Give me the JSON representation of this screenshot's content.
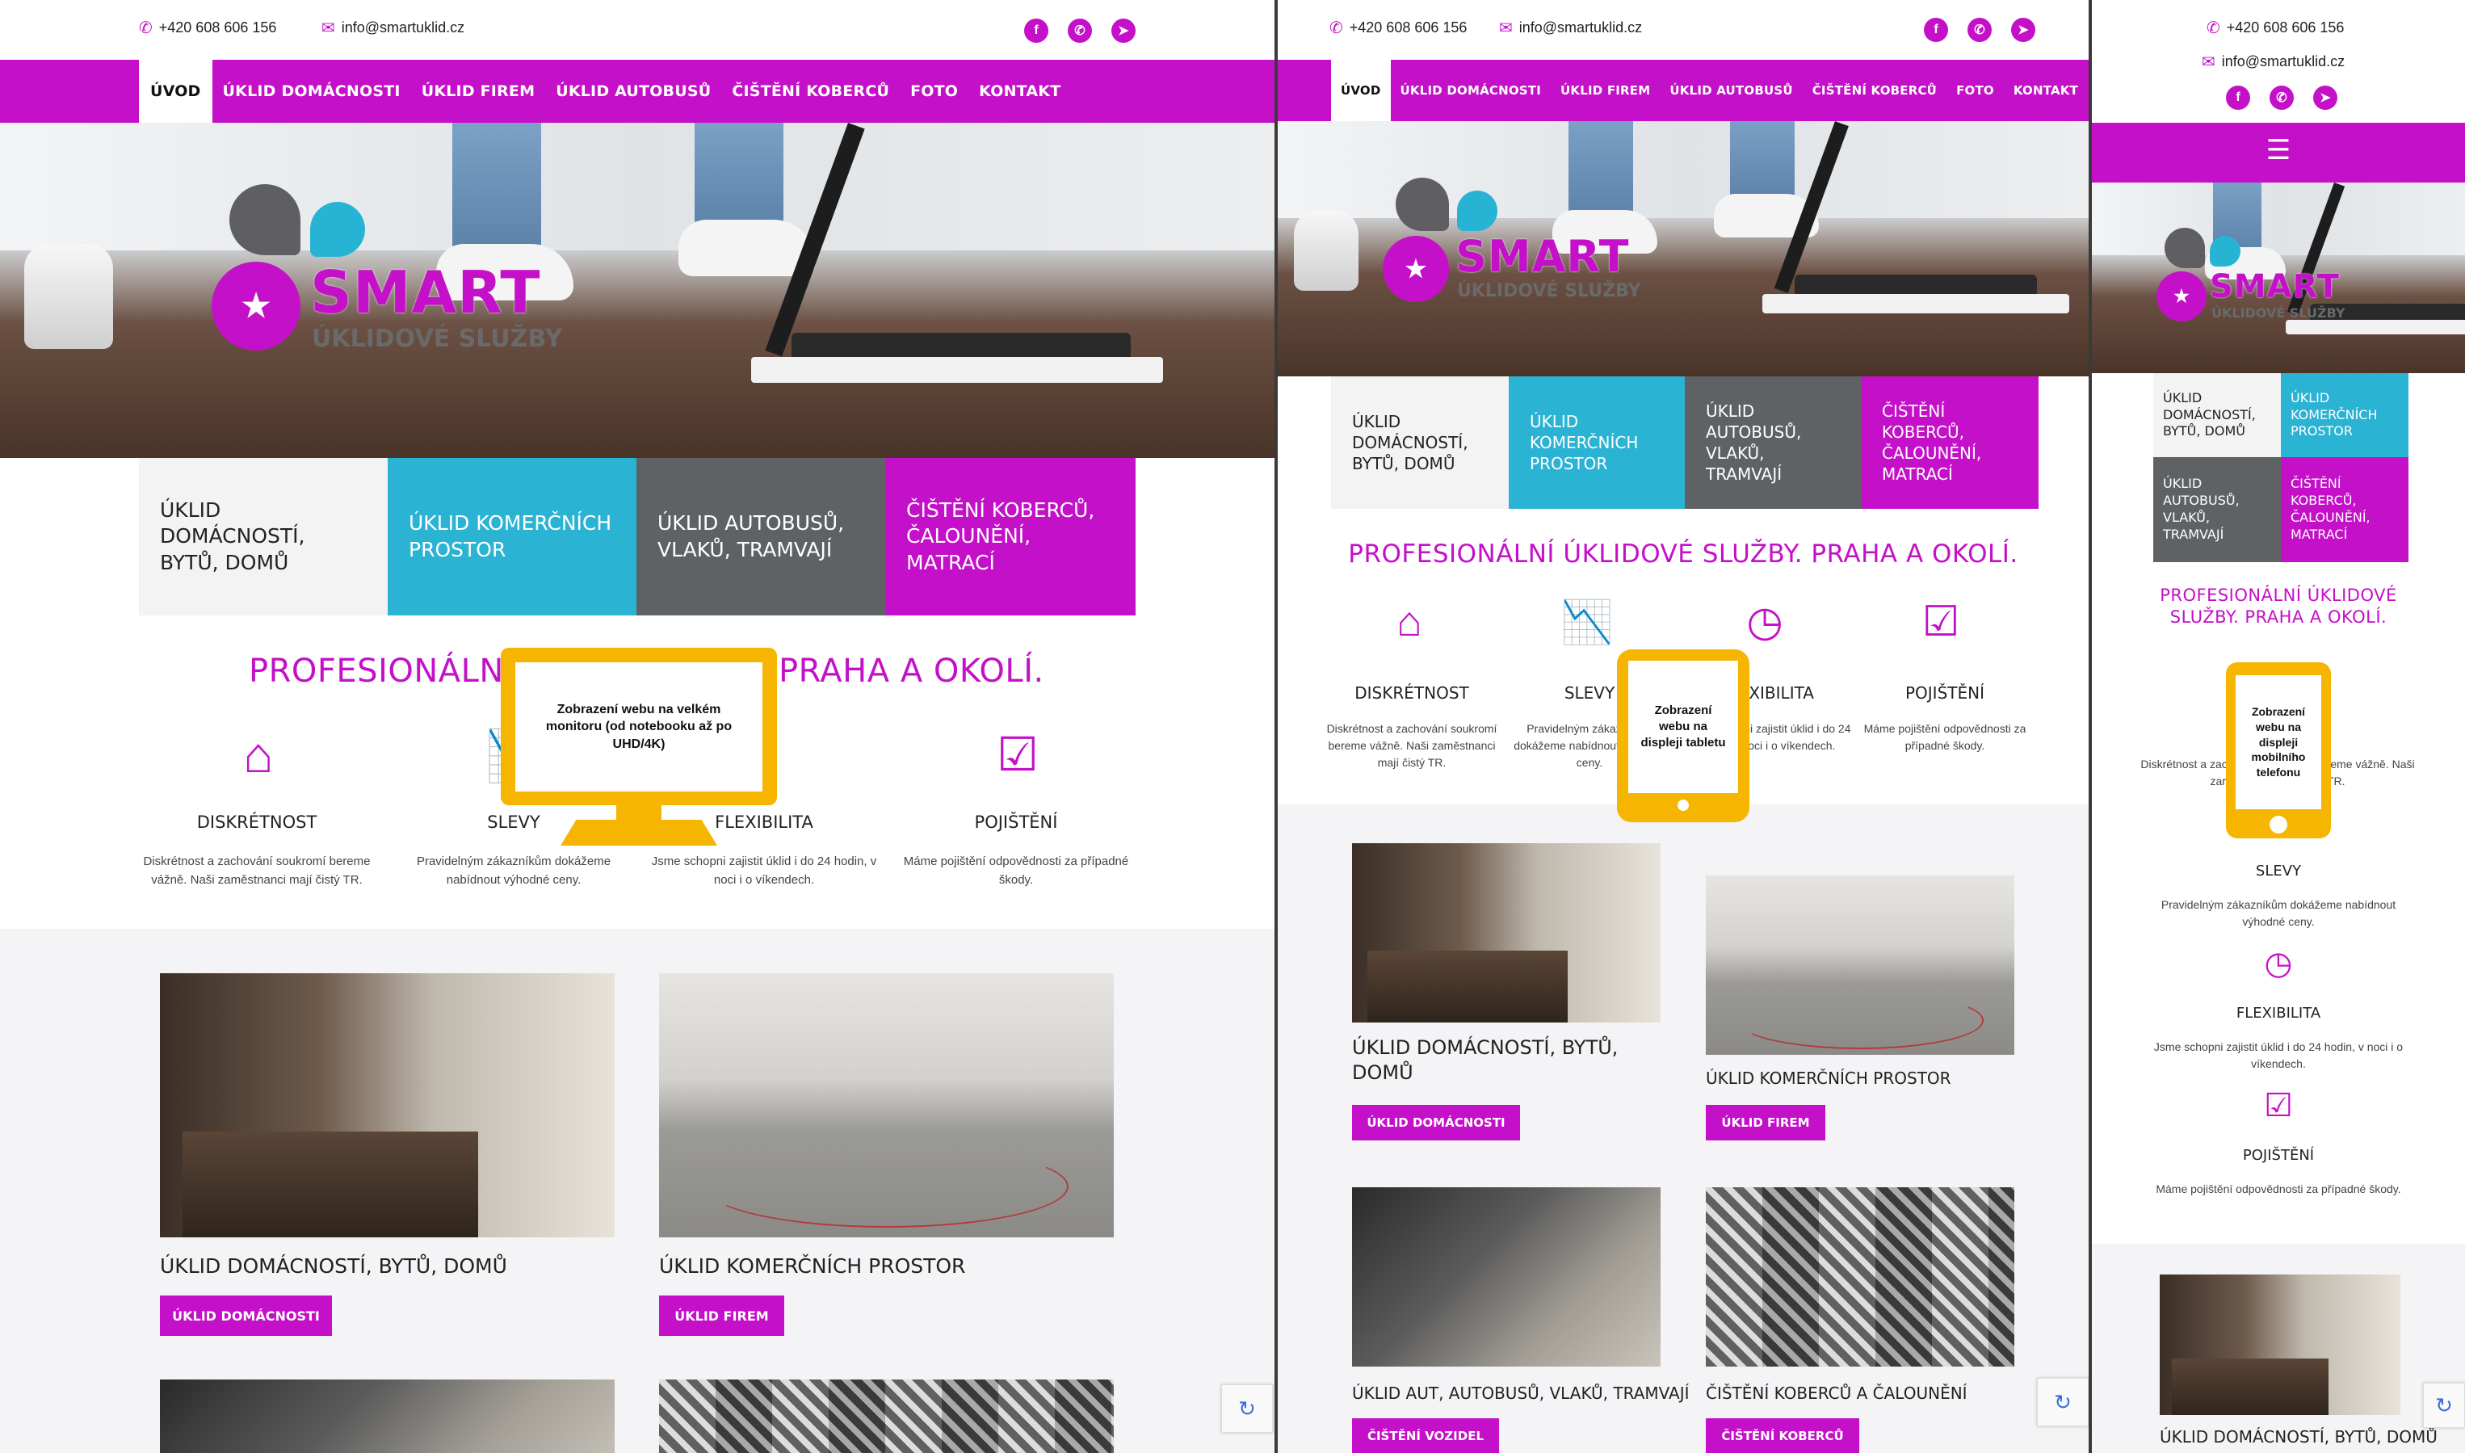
{
  "contact": {
    "phone": "+420 608 606 156",
    "email": "info@smartuklid.cz"
  },
  "social": [
    {
      "icon": "facebook-icon",
      "glyph": "f"
    },
    {
      "icon": "whatsapp-icon",
      "glyph": "✆"
    },
    {
      "icon": "telegram-icon",
      "glyph": "➤"
    }
  ],
  "nav": [
    {
      "label": "ÚVOD",
      "active": true
    },
    {
      "label": "ÚKLID DOMÁCNOSTI",
      "active": false
    },
    {
      "label": "ÚKLID FIREM",
      "active": false
    },
    {
      "label": "ÚKLID AUTOBUSŮ",
      "active": false
    },
    {
      "label": "ČIŠTĚNÍ KOBERCŮ",
      "active": false
    },
    {
      "label": "FOTO",
      "active": false
    },
    {
      "label": "KONTAKT",
      "active": false
    }
  ],
  "logo": {
    "brand": "SMART",
    "sub": "ÚKLIDOVÉ SLUŽBY"
  },
  "tiles": [
    "Úklid domácností, bytů, domů",
    "Úklid komerčních prostor",
    "Úklid autobusů, vlaků, tramvají",
    "Čištění koberců, čalounění, matrací"
  ],
  "heading": "PROFESIONÁLNÍ ÚKLIDOVÉ SLUŽBY. PRAHA A OKOLÍ.",
  "heading_left": "PROFESIONÁLNÍ Ú",
  "heading_right": "PRAHA A OKOLÍ.",
  "features": [
    {
      "title": "DISKRÉTNOST",
      "text": "Diskrétnost a zachování soukromí bereme vážně. Naši zaměstnanci mají čistý TR."
    },
    {
      "title": "SLEVY",
      "text": "Pravidelným zákazníkům dokážeme nabídnout výhodné ceny."
    },
    {
      "title": "FLEXIBILITA",
      "text": "Jsme schopni zajistit úklid i do 24 hodin, v noci i o víkendech."
    },
    {
      "title": "POJIŠTĚNÍ",
      "text": "Máme pojištění odpovědnosti za případné škody."
    }
  ],
  "cards": [
    {
      "title": "ÚKLID DOMÁCNOSTÍ, BYTŮ, DOMŮ",
      "button": "ÚKLID DOMÁCNOSTI"
    },
    {
      "title": "ÚKLID KOMERČNÍCH PROSTOR",
      "button": "ÚKLID FIREM"
    },
    {
      "title": "ÚKLID AUT, AUTOBUSŮ, VLAKŮ, TRAMVAJÍ",
      "button": "ČIŠTĚNÍ VOZIDEL"
    },
    {
      "title": "ČIŠTĚNÍ KOBERCŮ A ČALOUNĚNÍ",
      "button": "ČIŠTĚNÍ KOBERCŮ"
    }
  ],
  "overlays": {
    "monitor": "Zobrazení webu na velkém monitoru (od notebooku až po UHD/4K)",
    "tablet": "Zobrazení webu na displeji tabletu",
    "phone": "Zobrazení webu na displeji mobilního telefonu"
  },
  "menu_glyph": "☰",
  "colors": {
    "accent": "#c410c8",
    "cyan": "#2bb3d3",
    "gray": "#5e6265",
    "device": "#f5b500"
  }
}
